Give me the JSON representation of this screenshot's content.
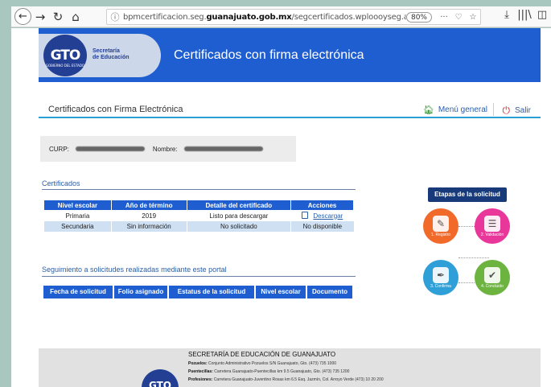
{
  "browser": {
    "url_prefix": "bpmcertificacion.seg.",
    "url_domain": "guanajuato.gob.mx",
    "url_suffix": "/segcertificados.wploooyseg.aso",
    "zoom": "80%",
    "more": "···",
    "pocket": "♡",
    "star": "☆",
    "download": "⤓",
    "library": "|||\\",
    "sidebar": "◫"
  },
  "header": {
    "logo_text": "GTO",
    "logo_small": "GOBIERNO DEL ESTADO",
    "logo_sub_line1": "Secretaría",
    "logo_sub_line2": "de Educación",
    "title": "Certificados con firma electrónica"
  },
  "subheader": {
    "title": "Certificados con Firma Electrónica",
    "menu": "Menú general",
    "exit": "Salir"
  },
  "identity": {
    "curp_label": "CURP:",
    "name_label": "Nombre:"
  },
  "certificates": {
    "title": "Certificados",
    "columns": [
      "Nivel escolar",
      "Año de término",
      "Detalle del certificado",
      "Acciones"
    ],
    "rows": [
      [
        "Primaria",
        "2019",
        "Listo para descargar",
        "Descargar"
      ],
      [
        "Secundaria",
        "Sin información",
        "No solicitado",
        "No disponible"
      ]
    ]
  },
  "tracking": {
    "title": "Seguimiento a solicitudes realizadas mediante este portal",
    "columns": [
      "Fecha de solicitud",
      "Folio asignado",
      "Estatus de la solicitud",
      "Nivel escolar",
      "Documento"
    ]
  },
  "stages": {
    "title": "Etapas de la solicitud",
    "items": [
      {
        "label": "1. Registro",
        "color": "#f26a2a"
      },
      {
        "label": "2. Validación",
        "color": "#e8369a"
      },
      {
        "label": "3. Confirma",
        "color": "#2f9fd8"
      },
      {
        "label": "4. Concluido",
        "color": "#6cb33f"
      }
    ]
  },
  "footer": {
    "title": "SECRETARÍA DE EDUCACIÓN DE GUANAJUATO",
    "lines": [
      {
        "label": "Pozuelos:",
        "text": "Conjunto Administrativo Pozuelos S/N Guanajuato, Gto. (473) 735 1000"
      },
      {
        "label": "Puentecillas:",
        "text": "Carretera Guanajuato-Puentecillas km 9.5 Guanajuato, Gto. (473) 735 1200"
      },
      {
        "label": "Profesiones:",
        "text": "Carretera Guanajuato-Juventino Rosas km 6.5 Esq. Jazmín, Col. Arroyo Verde (473) 10 20 200"
      }
    ],
    "logo_text": "GTO"
  }
}
